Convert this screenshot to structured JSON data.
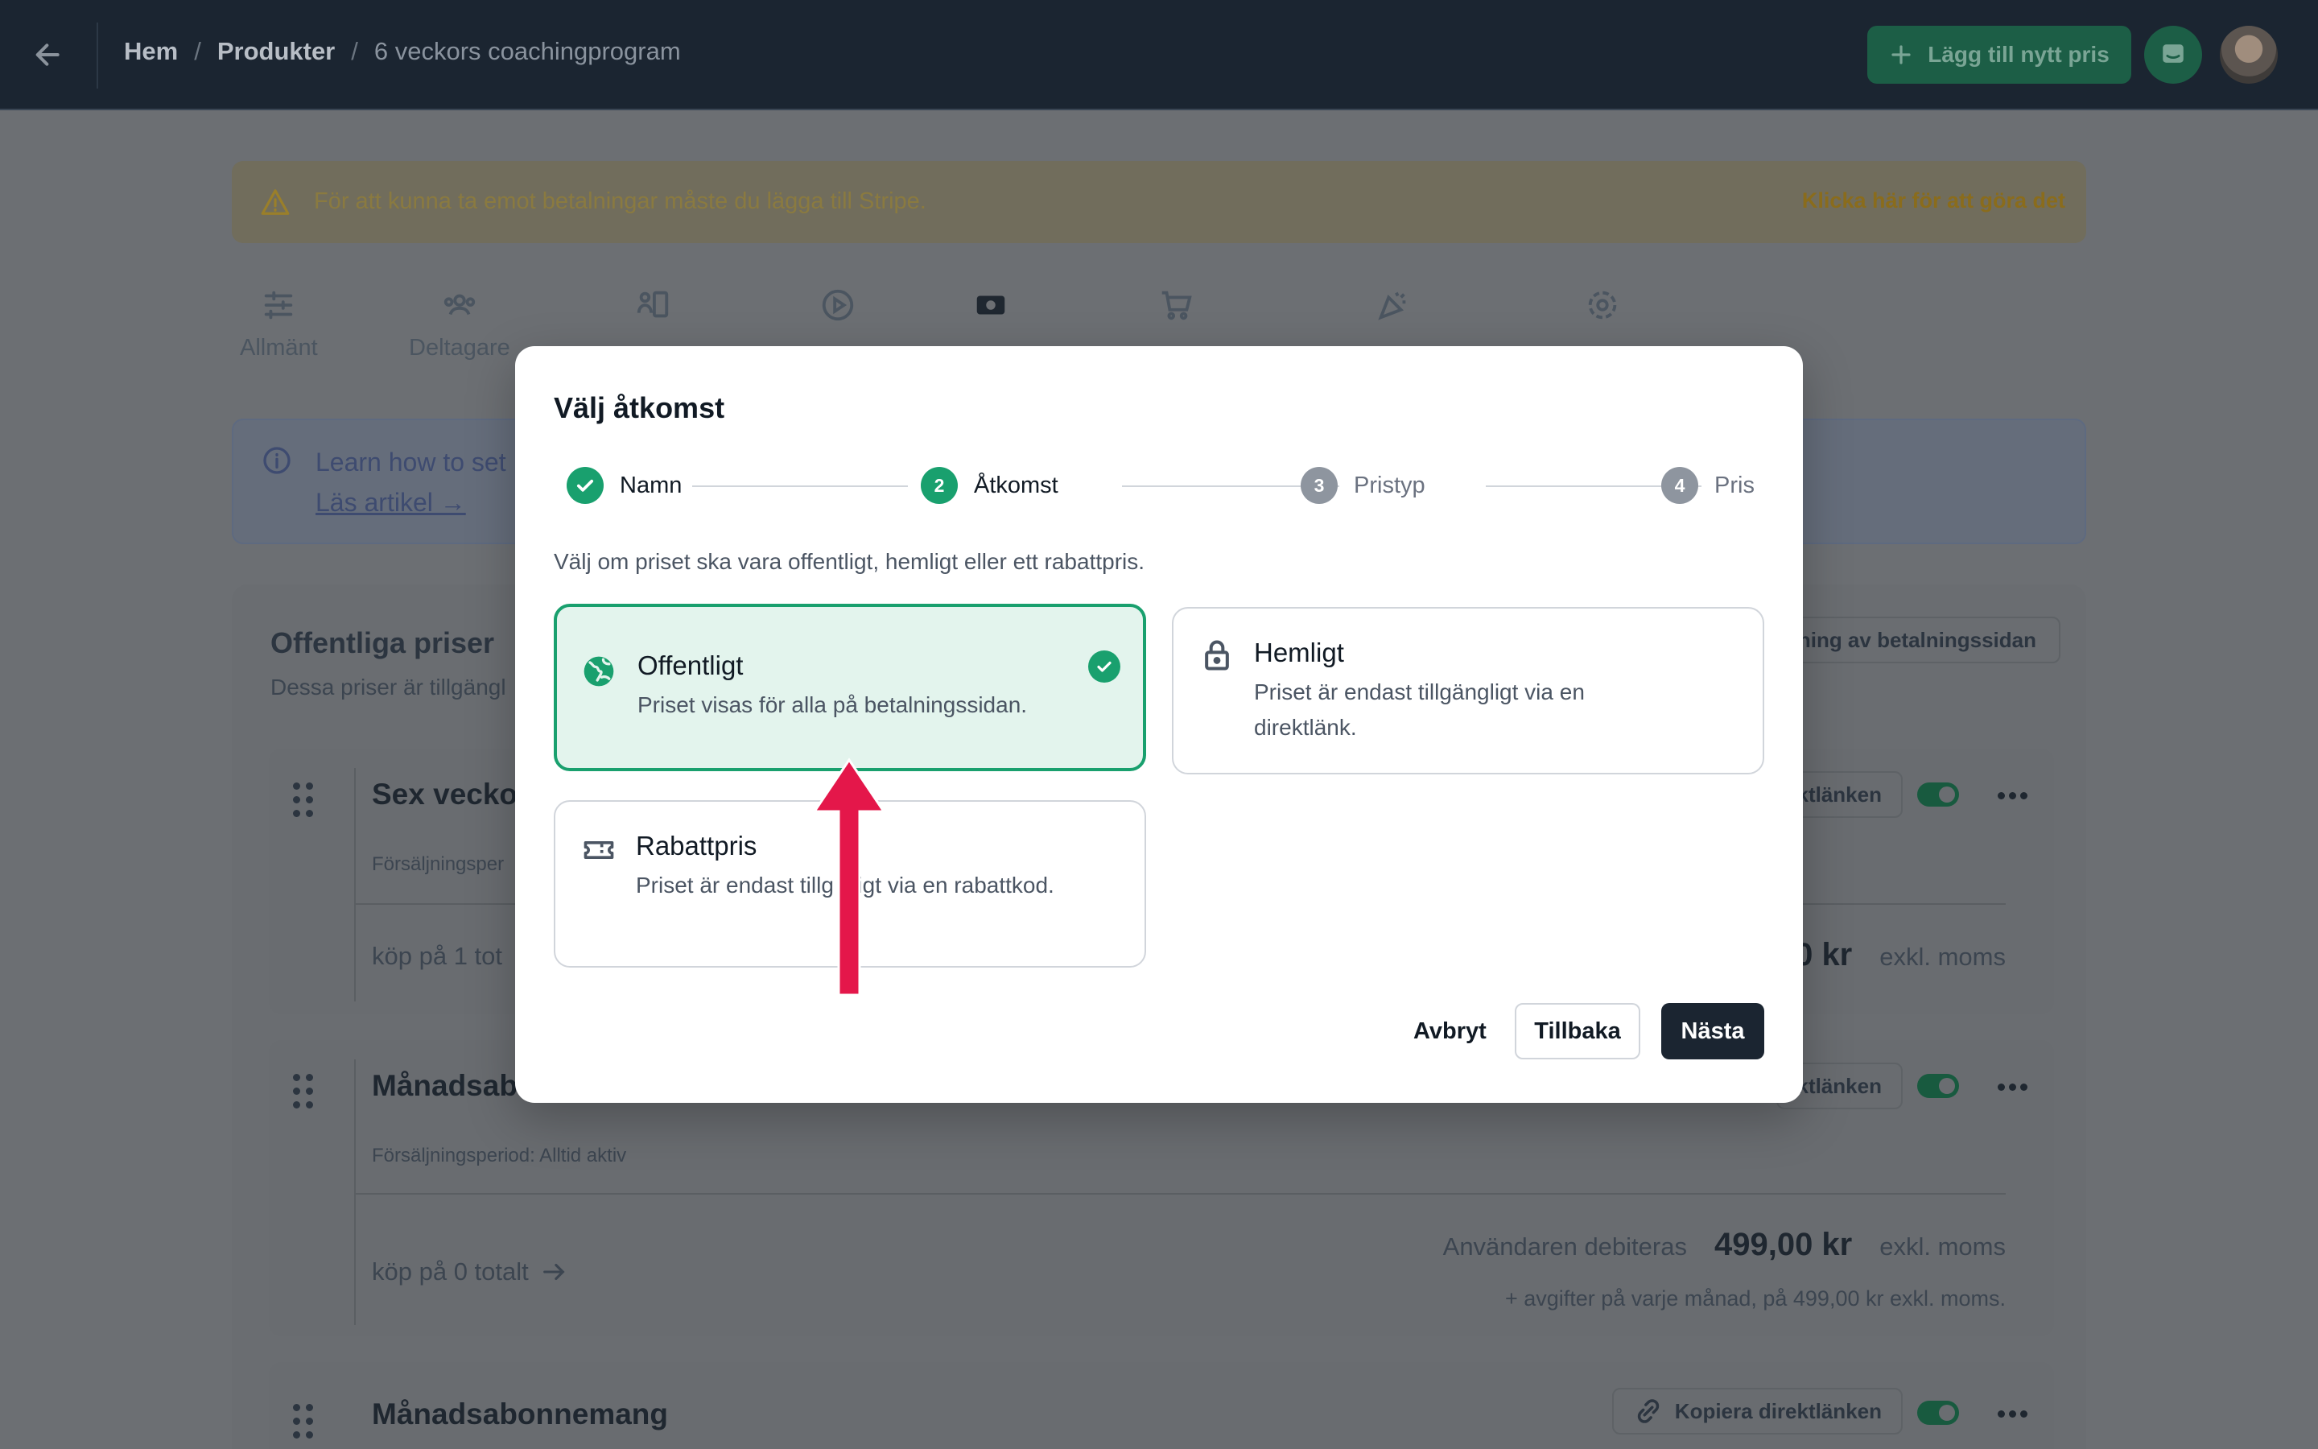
{
  "topbar": {
    "breadcrumb": [
      "Hem",
      "Produkter",
      "6 veckors coachingprogram"
    ],
    "add_price_label": "Lägg till nytt pris"
  },
  "warning": {
    "text": "För att kunna ta emot betalningar måste du lägga till Stripe.",
    "link": "Klicka här för att göra det"
  },
  "tabs": [
    "Allmänt",
    "Deltagare"
  ],
  "info": {
    "text": "Learn how to set",
    "link": "Läs artikel →"
  },
  "section": {
    "title": "Offentliga priser",
    "subtitle": "Dessa priser är tillgängl",
    "preview_label": "kning av betalningssidan"
  },
  "price_cards": [
    {
      "title": "Sex vecko",
      "period": "Försäljningsper",
      "buys": "köp på 1 tot",
      "amount": "0 kr",
      "tax": "exkl. moms",
      "copy_label": "ktlänken"
    },
    {
      "title": "Månadsab",
      "period": "Försäljningsperiod: Alltid aktiv",
      "buys": "köp på 0 totalt",
      "charge_label": "Användaren debiteras",
      "amount": "499,00 kr",
      "tax": "exkl. moms",
      "fee": "+ avgifter på varje månad, på 499,00 kr exkl. moms.",
      "copy_label": "ktlänken"
    },
    {
      "title": "Månadsabonnemang",
      "copy_label": "Kopiera direktlänken"
    }
  ],
  "modal": {
    "title": "Välj åtkomst",
    "steps": [
      {
        "number": "",
        "label": "Namn",
        "state": "done"
      },
      {
        "number": "2",
        "label": "Åtkomst",
        "state": "active"
      },
      {
        "number": "3",
        "label": "Pristyp",
        "state": "pending"
      },
      {
        "number": "4",
        "label": "Pris",
        "state": "pending"
      }
    ],
    "description": "Välj om priset ska vara offentligt, hemligt eller ett rabattpris.",
    "options": [
      {
        "title": "Offentligt",
        "desc": "Priset visas för alla på betalningssidan.",
        "selected": true,
        "icon": "globe-icon"
      },
      {
        "title": "Hemligt",
        "desc": "Priset är endast tillgängligt via en direktlänk.",
        "selected": false,
        "icon": "lock-icon"
      },
      {
        "title": "Rabattpris",
        "desc": "Priset är endast tillg gligt via en rabattkod.",
        "selected": false,
        "icon": "ticket-icon"
      }
    ],
    "buttons": {
      "cancel": "Avbryt",
      "back": "Tillbaka",
      "next": "Nästa"
    }
  },
  "colors": {
    "accent_green": "#19a06e",
    "dark": "#1b2531",
    "annotation_arrow": "#e4174a"
  }
}
